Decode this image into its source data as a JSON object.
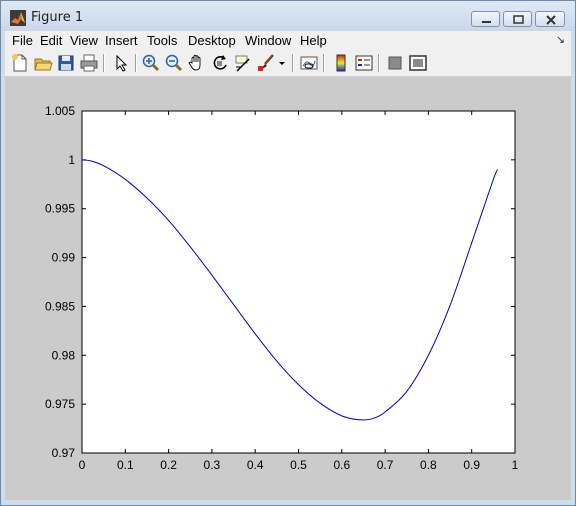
{
  "window": {
    "title": "Figure 1"
  },
  "menu": {
    "items": [
      "File",
      "Edit",
      "View",
      "Insert",
      "Tools",
      "Desktop",
      "Window",
      "Help"
    ],
    "dock_glyph": "↘"
  },
  "toolbar": {
    "icons": [
      "new-figure-icon",
      "open-file-icon",
      "save-icon",
      "print-icon",
      "pointer-icon",
      "zoom-in-icon",
      "zoom-out-icon",
      "pan-hand-icon",
      "rotate-3d-icon",
      "data-cursor-icon",
      "brush-icon",
      "brush-dropdown-icon",
      "link-plot-icon",
      "colorbar-icon",
      "legend-icon",
      "hide-plot-tools-icon",
      "show-plot-tools-icon"
    ]
  },
  "colors": {
    "line": "#0000c0",
    "canvas": "#cbcbcb",
    "axes_bg": "#ffffff"
  },
  "chart_data": {
    "type": "line",
    "title": "",
    "xlabel": "",
    "ylabel": "",
    "xlim": [
      0,
      1
    ],
    "ylim": [
      0.97,
      1.005
    ],
    "xticks": [
      "0",
      "0.1",
      "0.2",
      "0.3",
      "0.4",
      "0.5",
      "0.6",
      "0.7",
      "0.8",
      "0.9",
      "1"
    ],
    "yticks": [
      "0.97",
      "0.975",
      "0.98",
      "0.985",
      "0.99",
      "0.995",
      "1",
      "1.005"
    ],
    "grid": false,
    "series": [
      {
        "x": [
          0,
          0.02,
          0.05,
          0.1,
          0.15,
          0.2,
          0.25,
          0.3,
          0.35,
          0.4,
          0.45,
          0.5,
          0.55,
          0.6,
          0.64,
          0.67,
          0.7,
          0.75,
          0.8,
          0.85,
          0.9,
          0.95,
          0.96
        ],
        "y": [
          1.0,
          0.9999,
          0.9994,
          0.998,
          0.9961,
          0.9938,
          0.9911,
          0.9882,
          0.9852,
          0.9822,
          0.9794,
          0.977,
          0.9751,
          0.9738,
          0.9734,
          0.9735,
          0.9742,
          0.9763,
          0.98,
          0.9851,
          0.9915,
          0.998,
          0.999
        ]
      }
    ]
  }
}
